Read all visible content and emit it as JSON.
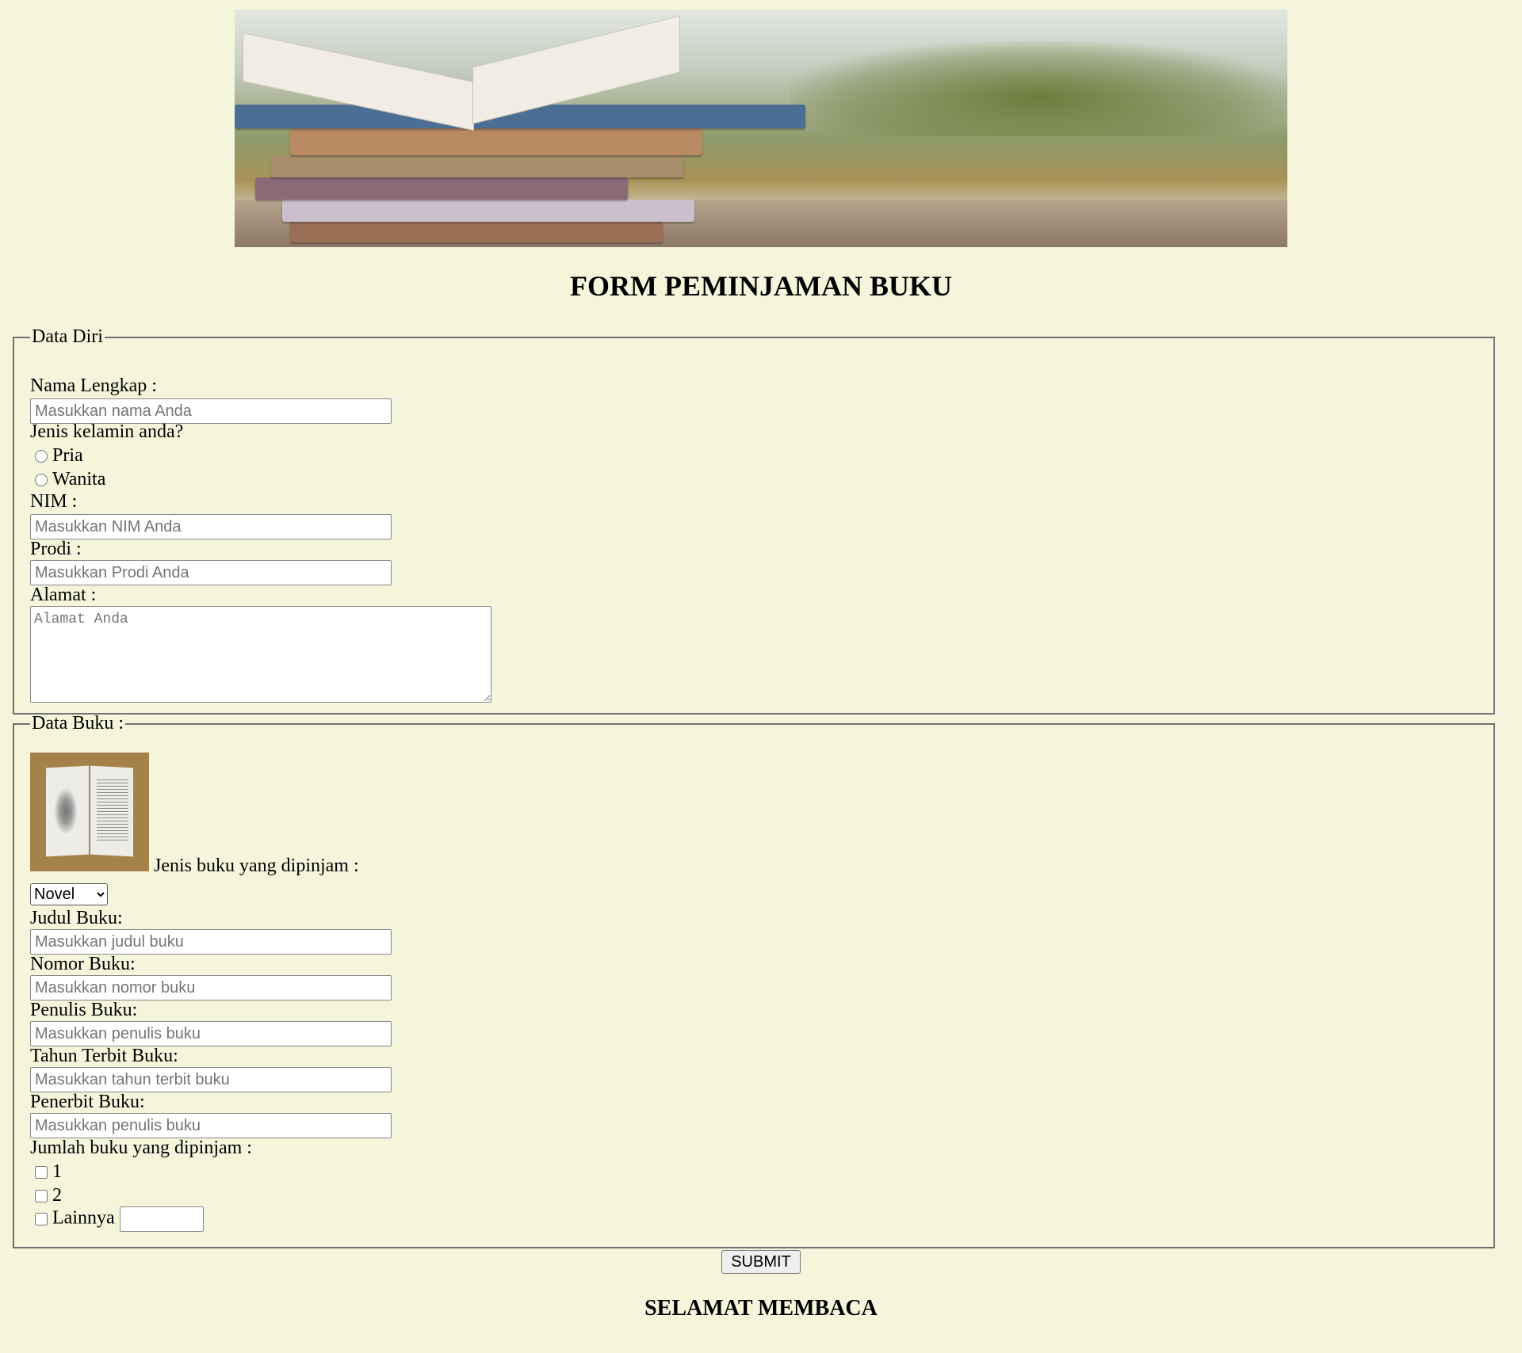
{
  "header": {
    "title": "FORM PEMINJAMAN BUKU"
  },
  "data_diri": {
    "legend": "Data Diri",
    "nama_label": "Nama Lengkap :",
    "nama_placeholder": "Masukkan nama Anda",
    "gender_label": "Jenis kelamin anda?",
    "gender_options": [
      "Pria",
      "Wanita"
    ],
    "nim_label": "NIM :",
    "nim_placeholder": "Masukkan NIM Anda",
    "prodi_label": "Prodi :",
    "prodi_placeholder": "Masukkan Prodi Anda",
    "alamat_label": "Alamat :",
    "alamat_placeholder": "Alamat Anda"
  },
  "data_buku": {
    "legend": "Data Buku :",
    "jenis_label": "Jenis buku yang dipinjam :",
    "jenis_selected": "Novel",
    "judul_label": "Judul Buku:",
    "judul_placeholder": "Masukkan judul buku",
    "nomor_label": "Nomor Buku:",
    "nomor_placeholder": "Masukkan nomor buku",
    "penulis_label": "Penulis Buku:",
    "penulis_placeholder": "Masukkan penulis buku",
    "tahun_label": "Tahun Terbit Buku:",
    "tahun_placeholder": "Masukkan tahun terbit buku",
    "penerbit_label": "Penerbit Buku:",
    "penerbit_placeholder": "Masukkan penulis buku",
    "jumlah_label": "Jumlah buku yang dipinjam :",
    "jumlah_options": [
      "1",
      "2",
      "Lainnya"
    ]
  },
  "actions": {
    "submit_label": "SUBMIT"
  },
  "footer": {
    "text": "SELAMAT MEMBACA"
  },
  "colors": {
    "background": "#f5f5dc",
    "border": "#707070"
  }
}
